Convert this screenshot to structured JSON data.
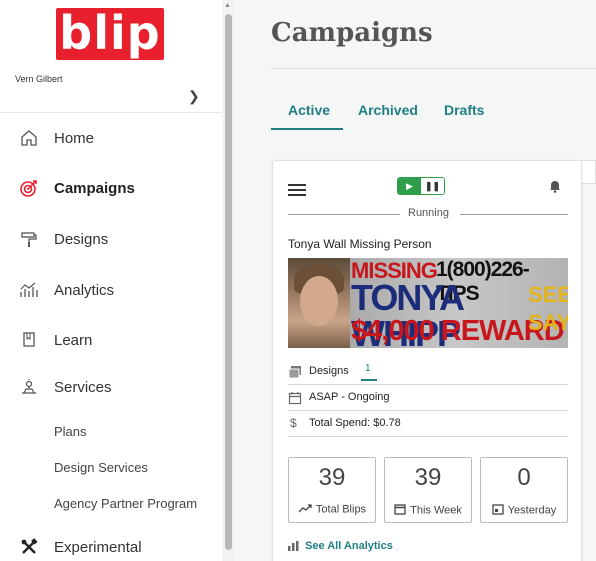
{
  "brand": {
    "logo_text": "blip",
    "color": "#e8202e"
  },
  "user": {
    "name": "Vern Gilbert"
  },
  "sidebar": {
    "items": [
      {
        "label": "Home",
        "icon": "home-icon"
      },
      {
        "label": "Campaigns",
        "icon": "target-icon",
        "active": true
      },
      {
        "label": "Designs",
        "icon": "paint-roller-icon"
      },
      {
        "label": "Analytics",
        "icon": "analytics-icon"
      },
      {
        "label": "Learn",
        "icon": "book-icon"
      },
      {
        "label": "Services",
        "icon": "services-icon"
      }
    ],
    "sub_items": [
      {
        "label": "Plans"
      },
      {
        "label": "Design Services"
      },
      {
        "label": "Agency Partner Program"
      }
    ],
    "experimental": {
      "label": "Experimental",
      "icon": "tools-icon"
    }
  },
  "main": {
    "title": "Campaigns",
    "tabs": [
      {
        "label": "Active",
        "active": true
      },
      {
        "label": "Archived"
      },
      {
        "label": "Drafts"
      }
    ],
    "accent_color": "#1f7e86"
  },
  "campaign_card": {
    "status": "Running",
    "name": "Tonya Wall Missing Person",
    "billboard": {
      "line1": "MISSING",
      "phone": "1(800)226-TIPS",
      "person": "TONYA WHIPP",
      "reward": "$4,000 REWARD",
      "see": "SEE",
      "say": "SAY"
    },
    "designs_label": "Designs",
    "designs_count": "1",
    "schedule": "ASAP - Ongoing",
    "total_spend": "Total Spend: $0.78",
    "stats": [
      {
        "value": "39",
        "label": "Total Blips",
        "icon": "trend-up-icon"
      },
      {
        "value": "39",
        "label": "This Week",
        "icon": "calendar-icon"
      },
      {
        "value": "0",
        "label": "Yesterday",
        "icon": "calendar-day-icon"
      }
    ],
    "see_all_label": "See All Analytics",
    "toggle_color": "#2e9e4a"
  }
}
